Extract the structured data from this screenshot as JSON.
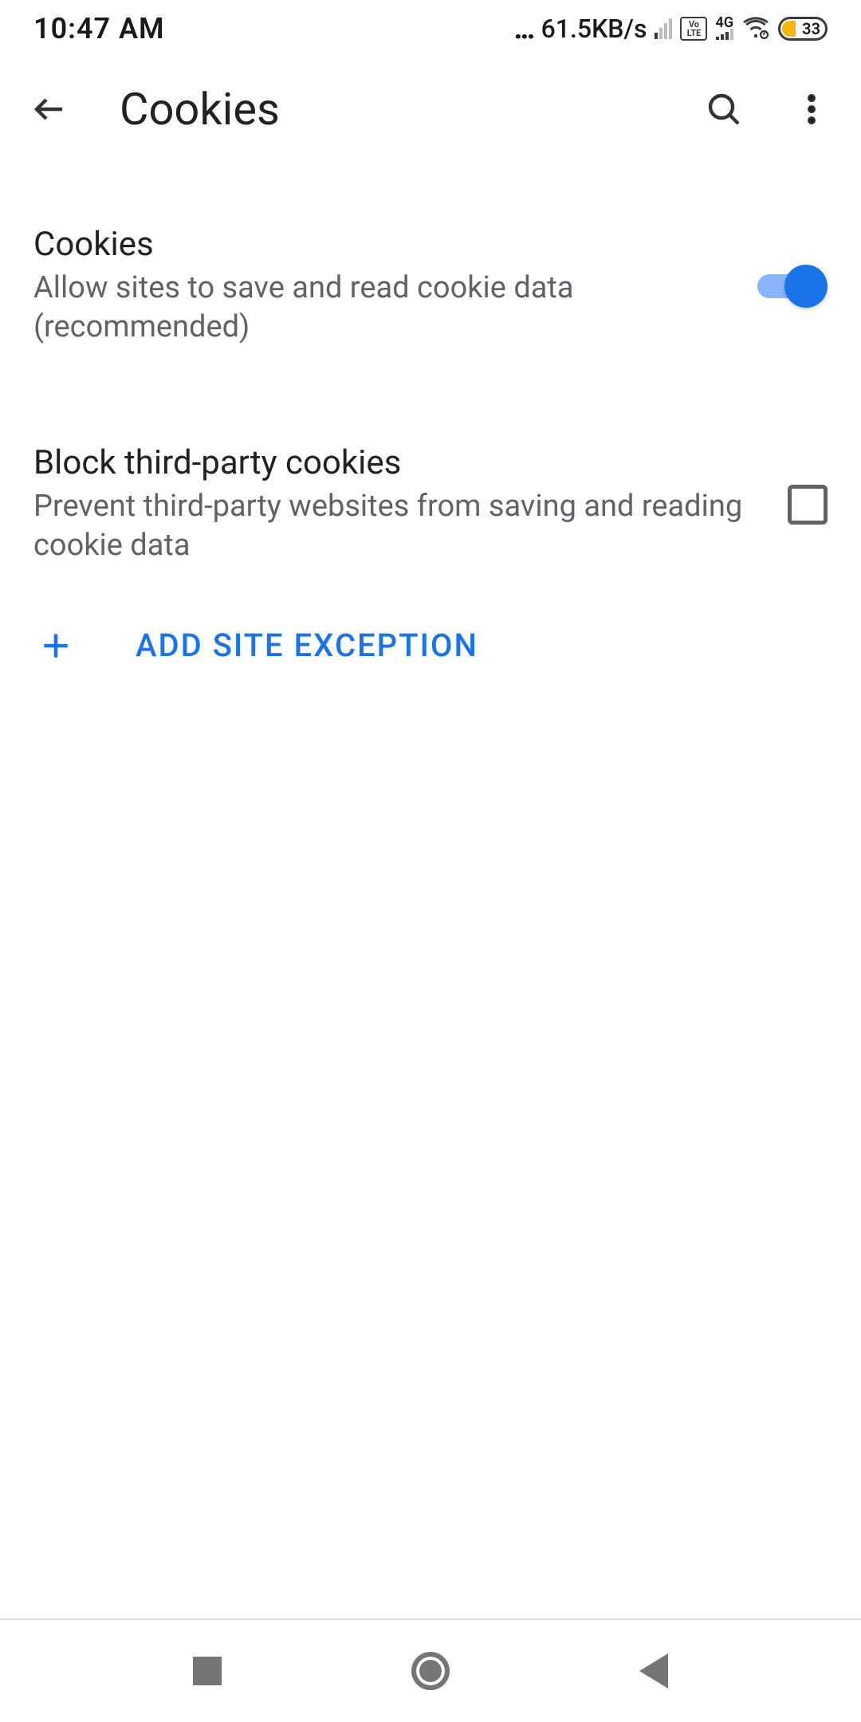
{
  "status": {
    "time": "10:47 AM",
    "speed": "61.5KB/s",
    "volte": "Vo LTE",
    "network": "4G",
    "battery": "33"
  },
  "header": {
    "title": "Cookies"
  },
  "settings": {
    "cookies": {
      "title": "Cookies",
      "subtitle": "Allow sites to save and read cookie data (recommended)",
      "enabled": true
    },
    "block_third_party": {
      "title": "Block third-party cookies",
      "subtitle": "Prevent third-party websites from saving and reading cookie data",
      "checked": false
    },
    "add_exception_label": "ADD SITE EXCEPTION"
  }
}
